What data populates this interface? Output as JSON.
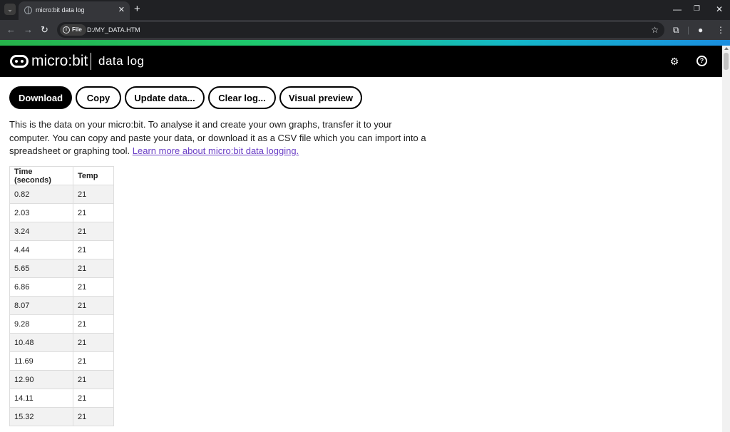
{
  "browser": {
    "tab_title": "micro:bit data log",
    "new_tab_glyph": "+",
    "url_chip": "File",
    "url": "D:/MY_DATA.HTM"
  },
  "app": {
    "logo_text": "micro:bit",
    "title": "data log"
  },
  "toolbar": {
    "download_label": "Download",
    "copy_label": "Copy",
    "update_label": "Update data...",
    "clear_label": "Clear log...",
    "preview_label": "Visual preview"
  },
  "intro": {
    "text": "This is the data on your micro:bit. To analyse it and create your own graphs, transfer it to your computer. You can copy and paste your data, or download it as a CSV file which you can import into a spreadsheet or graphing tool.",
    "link_text": "Learn more about micro:bit data logging."
  },
  "table": {
    "headers": [
      "Time (seconds)",
      "Temp"
    ],
    "rows": [
      [
        "0.82",
        "21"
      ],
      [
        "2.03",
        "21"
      ],
      [
        "3.24",
        "21"
      ],
      [
        "4.44",
        "21"
      ],
      [
        "5.65",
        "21"
      ],
      [
        "6.86",
        "21"
      ],
      [
        "8.07",
        "21"
      ],
      [
        "9.28",
        "21"
      ],
      [
        "10.48",
        "21"
      ],
      [
        "11.69",
        "21"
      ],
      [
        "12.90",
        "21"
      ],
      [
        "14.11",
        "21"
      ],
      [
        "15.32",
        "21"
      ]
    ]
  }
}
